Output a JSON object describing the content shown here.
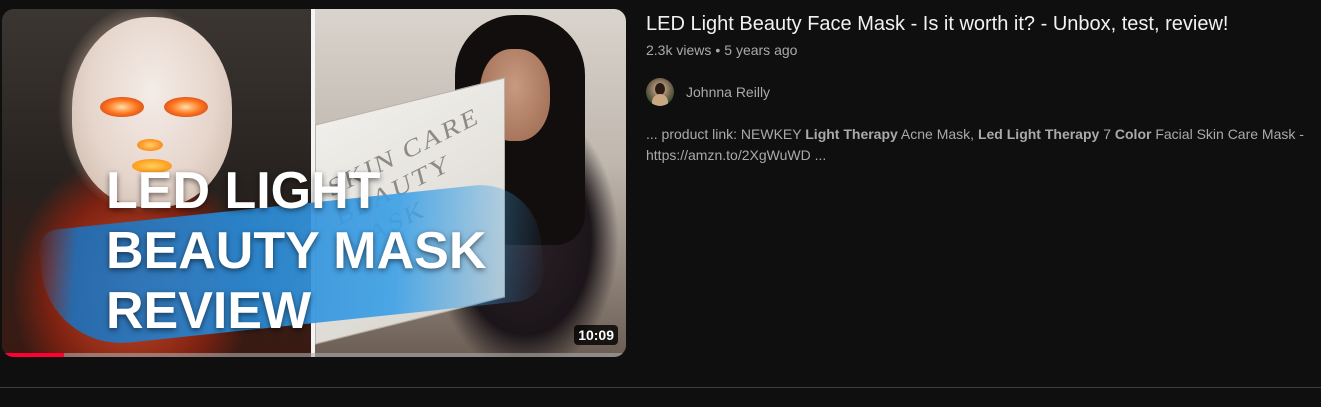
{
  "video": {
    "title": "LED Light Beauty Face Mask - Is it worth it? - Unbox, test, review!",
    "views": "2.3k views",
    "separator": "•",
    "age": "5 years ago",
    "duration": "10:09",
    "watch_progress": 0.1,
    "thumbnail": {
      "line1": "LED LIGHT",
      "line2": "BEAUTY MASK",
      "line3": "REVIEW",
      "box_line1": "SKIN CARE",
      "box_line2": "BEAUTY MASK"
    }
  },
  "channel": {
    "name": "Johnna Reilly"
  },
  "snippet": {
    "p1": "... product link: NEWKEY ",
    "b1": "Light Therapy",
    "p2": " Acne Mask, ",
    "b2": "Led Light Therapy",
    "p3": " 7 ",
    "b3": "Color",
    "p4": " Facial Skin Care Mask - ",
    "p5": "https://amzn.to/2XgWuWD ..."
  },
  "colors": {
    "background": "#0f0f0f",
    "progress": "#ff0033",
    "text_primary": "#f1f1f1",
    "text_secondary": "#aaaaaa"
  }
}
